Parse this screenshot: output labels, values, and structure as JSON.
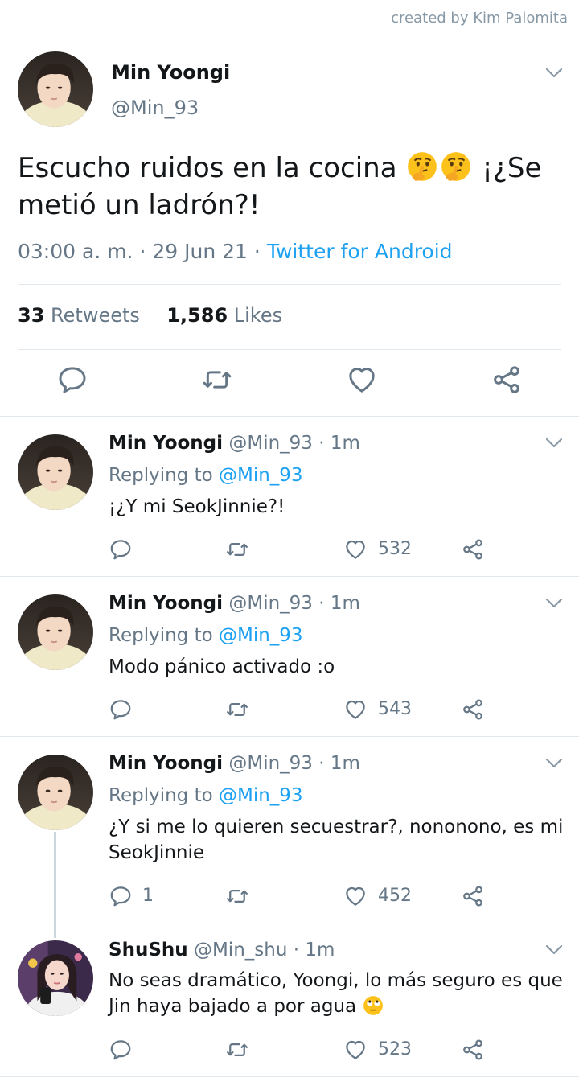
{
  "credit": "created by Kim Palomita",
  "main": {
    "name": "Min Yoongi",
    "handle": "@Min_93",
    "text_before": "Escucho ruidos en la cocina",
    "text_after": "¡¿Se metió un ladrón?!",
    "emojis": [
      "thinking-face-emoji",
      "thinking-face-emoji"
    ],
    "time": "03:00 a. m.",
    "date": "29 Jun 21",
    "source": "Twitter for Android",
    "retweets": "33",
    "retweets_label": "Retweets",
    "likes": "1,586",
    "likes_label": "Likes"
  },
  "replies": [
    {
      "name": "Min Yoongi",
      "handle": "@Min_93",
      "time": "1m",
      "replying_label": "Replying to",
      "replying_to": "@Min_93",
      "text": "¡¿Y mi SeokJinnie?!",
      "replies": "",
      "likes": "532"
    },
    {
      "name": "Min Yoongi",
      "handle": "@Min_93",
      "time": "1m",
      "replying_label": "Replying to",
      "replying_to": "@Min_93",
      "text": "Modo pánico activado :o",
      "replies": "",
      "likes": "543"
    },
    {
      "name": "Min Yoongi",
      "handle": "@Min_93",
      "time": "1m",
      "replying_label": "Replying to",
      "replying_to": "@Min_93",
      "text": "¿Y si me lo quieren secuestrar?, nononono, es mi SeokJinnie",
      "replies": "1",
      "likes": "452"
    },
    {
      "name": "ShuShu",
      "handle": "@Min_shu",
      "time": "1m",
      "text": "No seas dramático, Yoongi, lo más seguro es que Jin haya bajado a por agua",
      "emoji": "face-with-rolling-eyes-emoji",
      "replies": "",
      "likes": "523"
    }
  ],
  "separator": "·",
  "colors": {
    "accent": "#1da1f2",
    "secondary_text": "#657786",
    "divider": "#e1e8ed",
    "icon": "#657786"
  }
}
